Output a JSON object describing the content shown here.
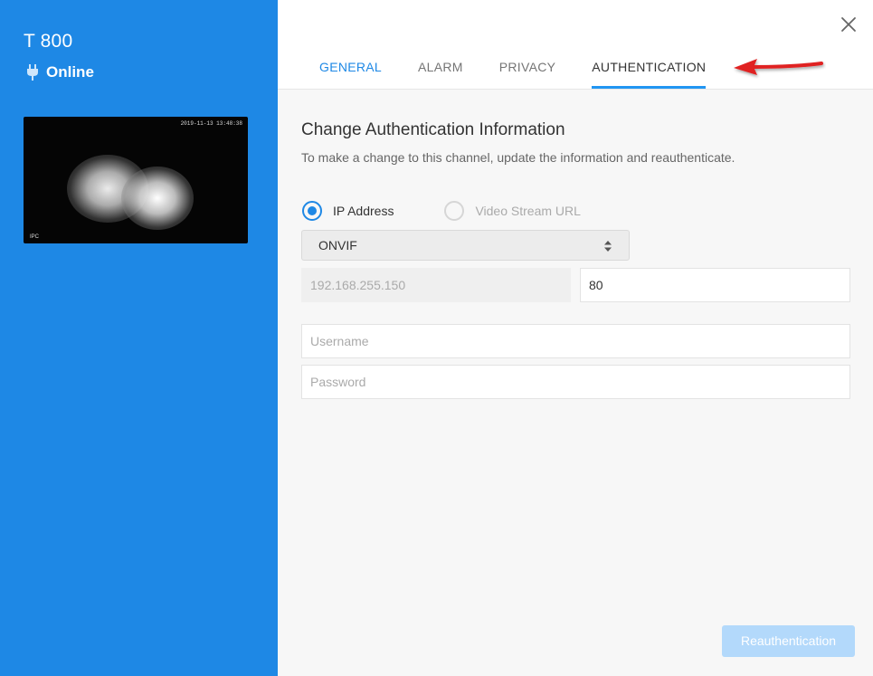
{
  "camera": {
    "name": "T 800",
    "status": "Online",
    "preview_timestamp": "2019-11-13 13:48:38",
    "preview_label": "IPC"
  },
  "tabs": [
    {
      "label": "GENERAL"
    },
    {
      "label": "ALARM"
    },
    {
      "label": "PRIVACY"
    },
    {
      "label": "AUTHENTICATION"
    }
  ],
  "section": {
    "title": "Change Authentication Information",
    "subtitle": "To make a change to this channel, update the information and reauthenticate."
  },
  "source_options": {
    "ip_address": "IP Address",
    "video_stream_url": "Video Stream URL"
  },
  "protocol": {
    "selected": "ONVIF"
  },
  "ip_field": {
    "value": "192.168.255.150"
  },
  "port_field": {
    "value": "80"
  },
  "username_field": {
    "placeholder": "Username"
  },
  "password_field": {
    "placeholder": "Password"
  },
  "actions": {
    "reauth_label": "Reauthentication"
  },
  "colors": {
    "sidebar": "#1e88e5",
    "accent": "#2196f3",
    "button_disabled": "#b3d9fb",
    "arrow": "#e02020"
  }
}
